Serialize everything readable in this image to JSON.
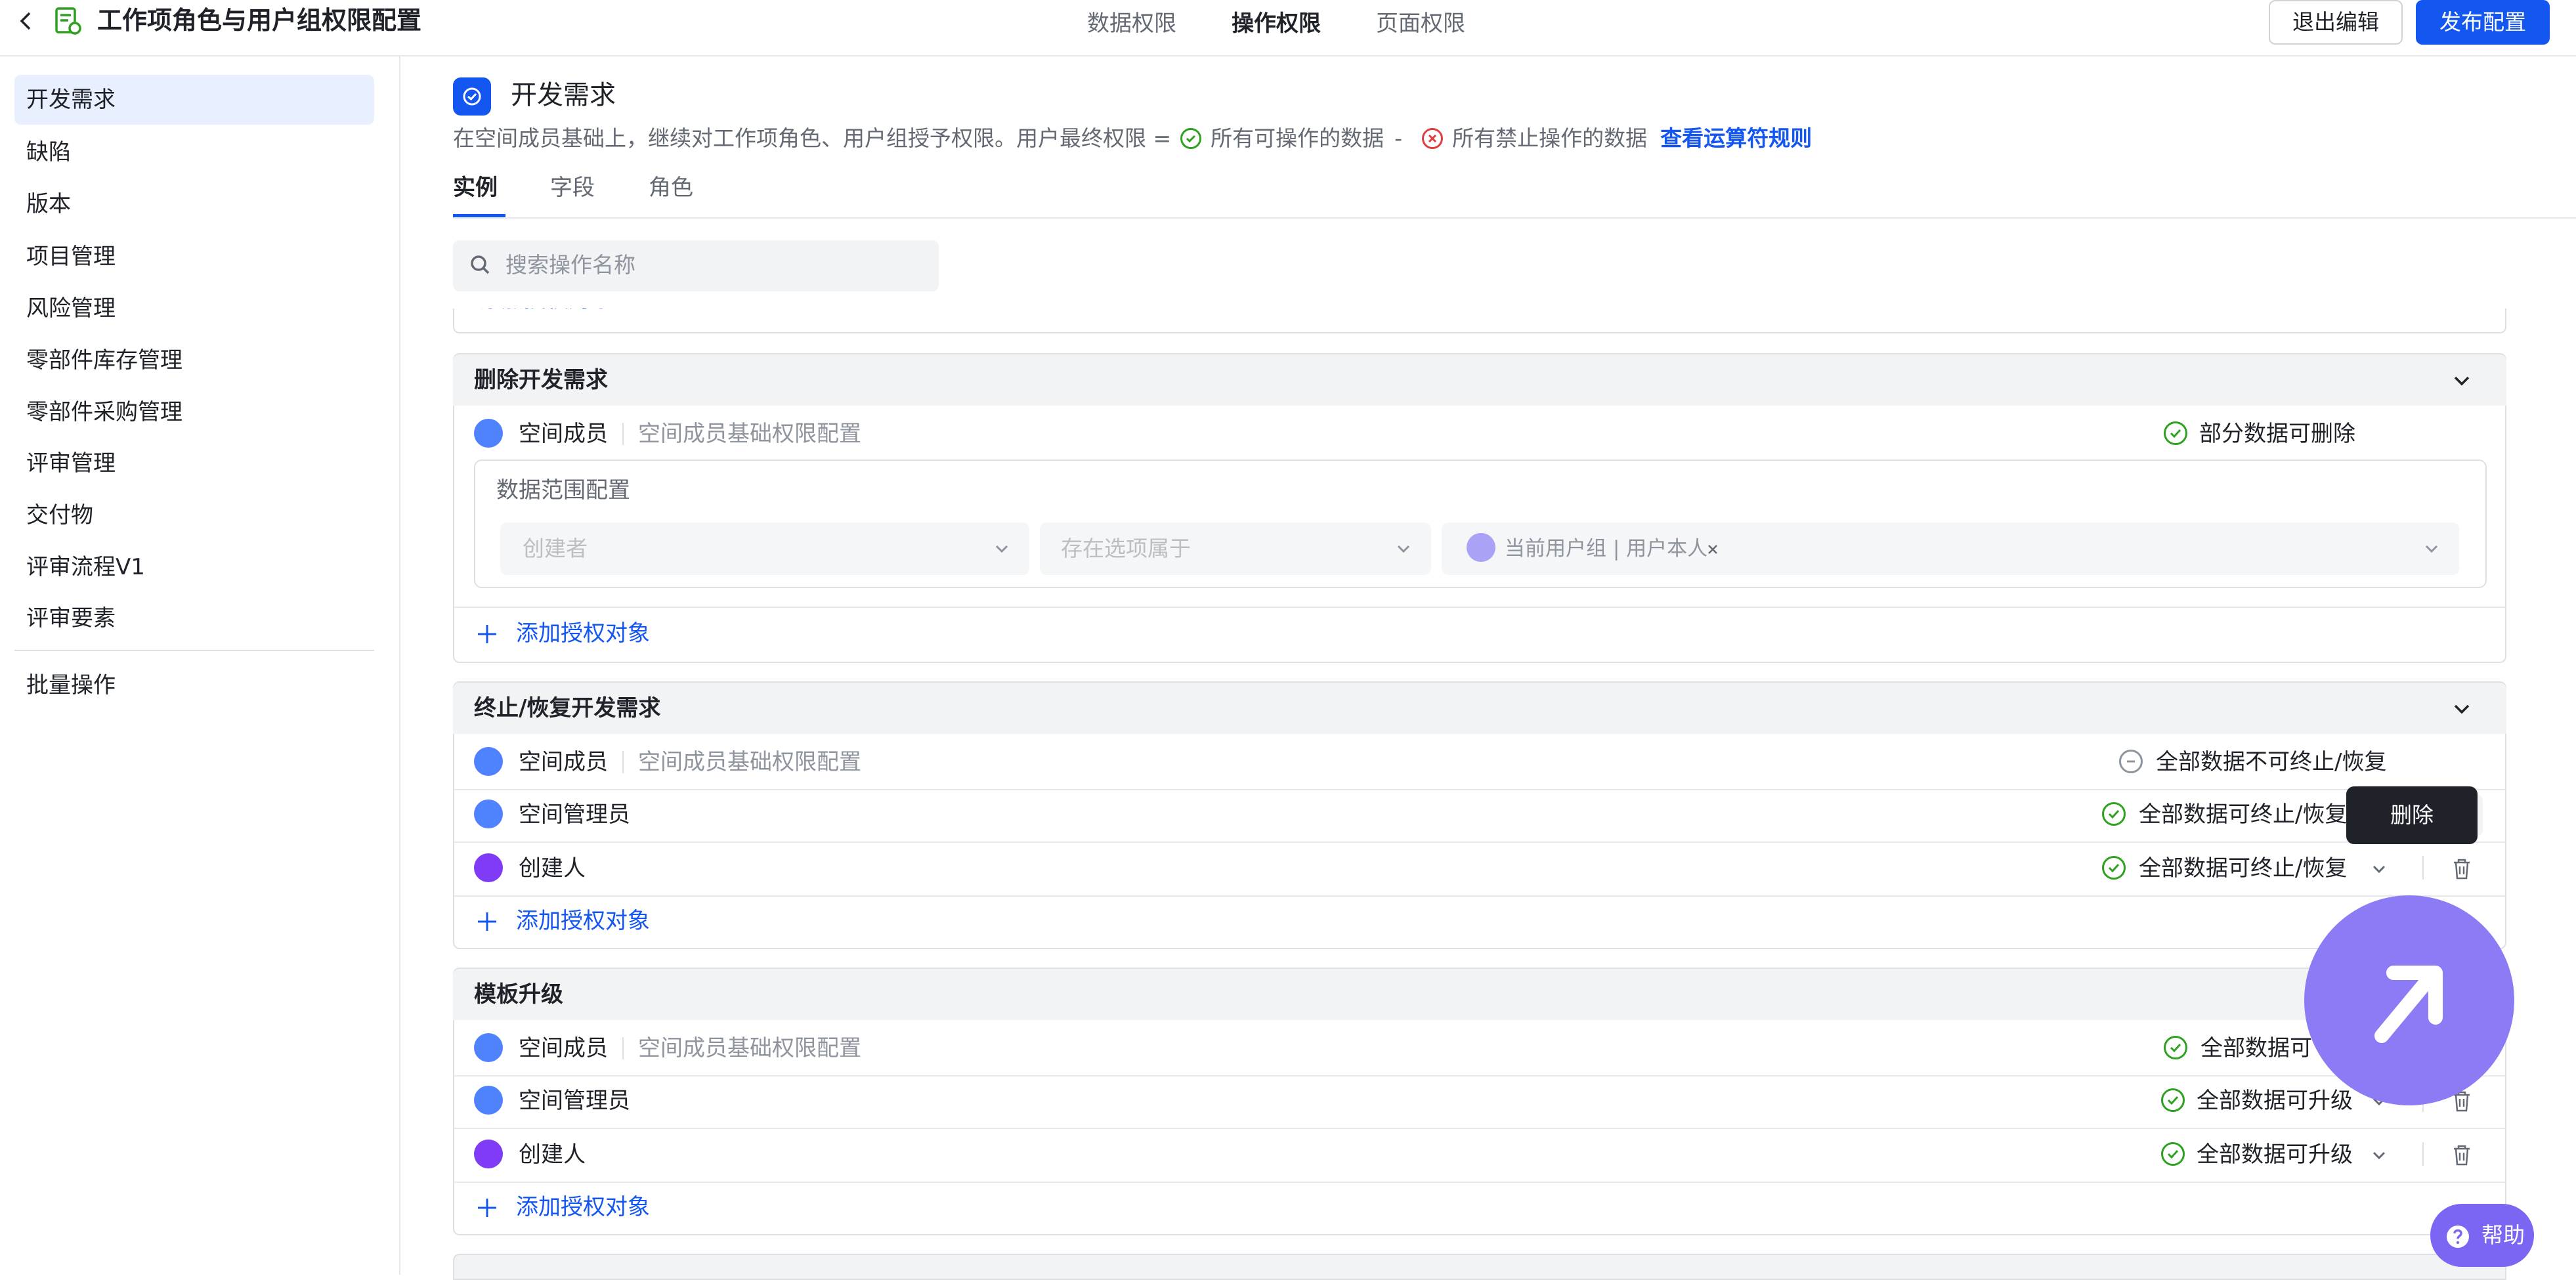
{
  "header": {
    "title": "工作项角色与用户组权限配置",
    "tabs": [
      "数据权限",
      "操作权限",
      "页面权限"
    ],
    "active_tab": "操作权限",
    "exit_label": "退出编辑",
    "publish_label": "发布配置"
  },
  "sidebar": {
    "items": [
      "开发需求",
      "缺陷",
      "版本",
      "项目管理",
      "风险管理",
      "零部件库存管理",
      "零部件采购管理",
      "评审管理",
      "交付物",
      "评审流程V1",
      "评审要素"
    ],
    "active": "开发需求",
    "batch_label": "批量操作"
  },
  "main": {
    "entity_title": "开发需求",
    "description_prefix": "在空间成员基础上，继续对工作项角色、用户组授予权限。用户最终权限 =",
    "allowed_text": "所有可操作的数据",
    "minus": "-",
    "forbidden_text": "所有禁止操作的数据",
    "rules_link": "查看运算符规则",
    "subtabs": [
      "实例",
      "字段",
      "角色"
    ],
    "active_subtab": "实例",
    "search_placeholder": "搜索操作名称",
    "partial_add_label": "添加授权对象"
  },
  "sections": [
    {
      "title": "删除开发需求",
      "rows": [
        {
          "name": "空间成员",
          "desc": "空间成员基础权限配置",
          "perm": "部分数据可删除",
          "perm_state": "ok"
        }
      ],
      "filter": {
        "label": "数据范围配置",
        "field": "创建者",
        "operator": "存在选项属于",
        "value": "当前用户组 | 用户本人"
      },
      "add_label": "添加授权对象"
    },
    {
      "title": "终止/恢复开发需求",
      "rows": [
        {
          "name": "空间成员",
          "desc": "空间成员基础权限配置",
          "perm": "全部数据不可终止/恢复",
          "perm_state": "none"
        },
        {
          "name": "空间管理员",
          "perm": "全部数据可终止/恢复",
          "perm_state": "ok"
        },
        {
          "name": "创建人",
          "perm": "全部数据可终止/恢复",
          "perm_state": "ok"
        }
      ],
      "add_label": "添加授权对象"
    },
    {
      "title": "模板升级",
      "rows": [
        {
          "name": "空间成员",
          "desc": "空间成员基础权限配置",
          "perm": "全部数据可",
          "perm_state": "ok"
        },
        {
          "name": "空间管理员",
          "perm": "全部数据可升级",
          "perm_state": "ok"
        },
        {
          "name": "创建人",
          "perm": "全部数据可升级",
          "perm_state": "ok"
        }
      ],
      "add_label": "添加授权对象"
    }
  ],
  "tooltip": "删除",
  "help_label": "帮助",
  "icons": [
    "back-icon",
    "document-icon",
    "check-circle-icon",
    "close-circle-icon",
    "search-icon",
    "chevron-down-icon",
    "user-group-icon",
    "user-icon",
    "plus-icon",
    "trash-icon",
    "arrow-up-right-icon",
    "question-icon"
  ],
  "colors": {
    "accent": "#1456f0",
    "success": "#2ea121",
    "danger": "#e03e3e",
    "fab": "#8b7cf6"
  }
}
